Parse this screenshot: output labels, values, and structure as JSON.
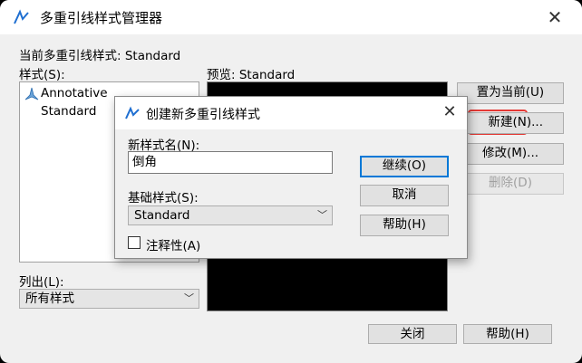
{
  "main": {
    "title": "多重引线样式管理器",
    "current_style": "当前多重引线样式: Standard",
    "styles_label": "样式(S):",
    "preview_label": "预览: Standard",
    "styles": [
      "Annotative",
      "Standard"
    ],
    "list_label": "列出(L):",
    "list_value": "所有样式",
    "buttons": {
      "set_current": "置为当前(U)",
      "new": "新建(N)...",
      "modify": "修改(M)...",
      "delete": "删除(D)",
      "close": "关闭",
      "help": "帮助(H)"
    }
  },
  "dialog": {
    "title": "创建新多重引线样式",
    "new_name_label": "新样式名(N):",
    "new_name_value": "倒角",
    "base_label": "基础样式(S):",
    "base_value": "Standard",
    "annotative_label": "注释性(A)",
    "annotative_checked": false,
    "buttons": {
      "continue": "继续(O)",
      "cancel": "取消",
      "help": "帮助(H)"
    }
  },
  "colors": {
    "highlight": "#e53935",
    "icon_blue": "#1f6fd1"
  }
}
